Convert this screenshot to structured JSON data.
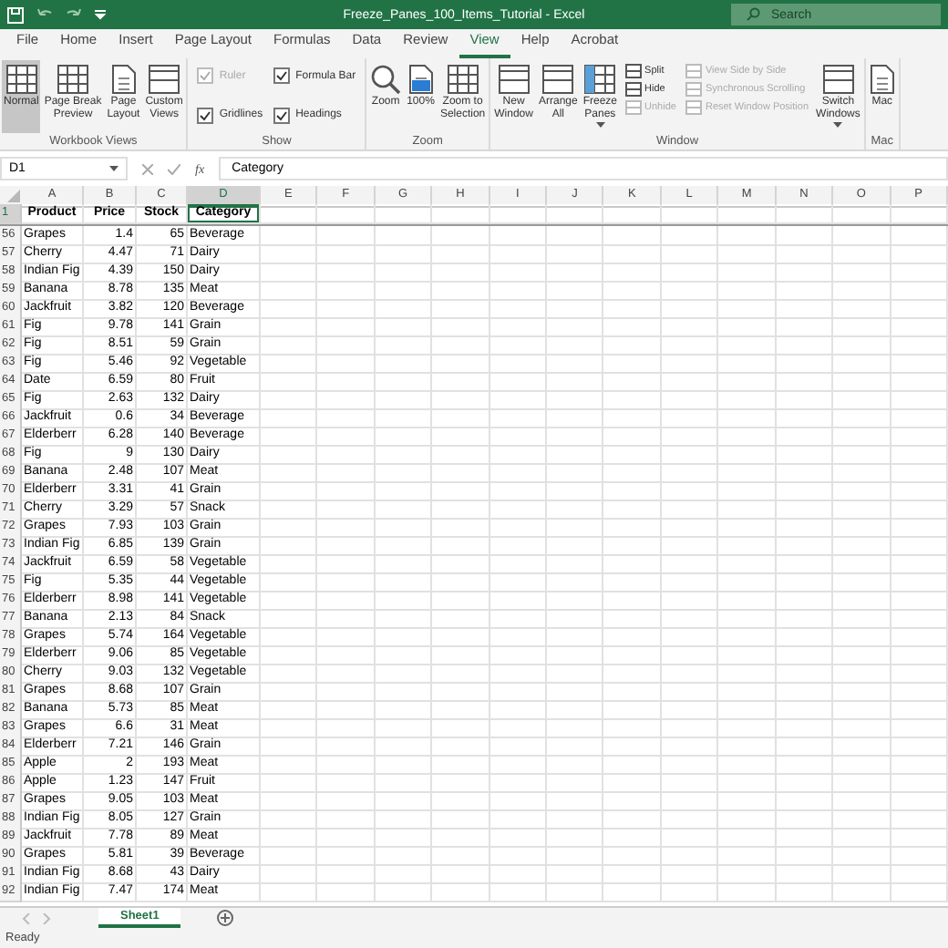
{
  "title_bar": {
    "title": "Freeze_Panes_100_Items_Tutorial  -  Excel",
    "search_placeholder": "Search"
  },
  "menu_tabs": [
    {
      "label": "File",
      "selected": false
    },
    {
      "label": "Home",
      "selected": false
    },
    {
      "label": "Insert",
      "selected": false
    },
    {
      "label": "Page Layout",
      "selected": false
    },
    {
      "label": "Formulas",
      "selected": false
    },
    {
      "label": "Data",
      "selected": false
    },
    {
      "label": "Review",
      "selected": false
    },
    {
      "label": "View",
      "selected": true
    },
    {
      "label": "Help",
      "selected": false
    },
    {
      "label": "Acrobat",
      "selected": false
    }
  ],
  "ribbon_groups": [
    {
      "name": "Workbook Views",
      "items": [
        {
          "kind": "large",
          "label": "Normal",
          "selected": true,
          "dropdown": false
        },
        {
          "kind": "large",
          "label": "Page Break\nPreview",
          "selected": false,
          "dropdown": false
        },
        {
          "kind": "large",
          "label": "Page\nLayout",
          "selected": false,
          "dropdown": false
        },
        {
          "kind": "large",
          "label": "Custom\nViews",
          "selected": false,
          "dropdown": false
        }
      ]
    },
    {
      "name": "Show",
      "items": [
        {
          "kind": "check",
          "label": "Ruler",
          "checked": true,
          "disabled": true
        },
        {
          "kind": "check",
          "label": "Gridlines",
          "checked": true,
          "disabled": false
        },
        {
          "kind": "check",
          "label": "Formula Bar",
          "checked": true,
          "disabled": false
        },
        {
          "kind": "check",
          "label": "Headings",
          "checked": true,
          "disabled": false
        }
      ]
    },
    {
      "name": "Zoom",
      "items": [
        {
          "kind": "large",
          "label": "Zoom",
          "selected": false,
          "dropdown": false
        },
        {
          "kind": "large",
          "label": "100%",
          "selected": false,
          "dropdown": false
        },
        {
          "kind": "large",
          "label": "Zoom to\nSelection",
          "selected": false,
          "dropdown": false
        }
      ]
    },
    {
      "name": "Window",
      "items": [
        {
          "kind": "large",
          "label": "New\nWindow",
          "selected": false,
          "dropdown": false
        },
        {
          "kind": "large",
          "label": "Arrange\nAll",
          "selected": false,
          "dropdown": false
        },
        {
          "kind": "large",
          "label": "Freeze\nPanes",
          "selected": false,
          "dropdown": true
        },
        {
          "kind": "stack",
          "items": [
            {
              "label": "Split",
              "disabled": false
            },
            {
              "label": "Hide",
              "disabled": false
            },
            {
              "label": "Unhide",
              "disabled": true
            }
          ]
        },
        {
          "kind": "stack",
          "items": [
            {
              "label": "View Side by Side",
              "disabled": true
            },
            {
              "label": "Synchronous Scrolling",
              "disabled": true
            },
            {
              "label": "Reset Window Position",
              "disabled": true
            }
          ]
        },
        {
          "kind": "large",
          "label": "Switch\nWindows",
          "selected": false,
          "dropdown": true
        }
      ]
    },
    {
      "name": "Mac",
      "items": [
        {
          "kind": "large",
          "label": "Mac",
          "selected": false,
          "dropdown": false
        }
      ]
    }
  ],
  "formula_bar": {
    "name_box": "D1",
    "function_label": "fx",
    "value": "Category"
  },
  "columns": [
    {
      "label": "A",
      "selected": false
    },
    {
      "label": "B",
      "selected": false
    },
    {
      "label": "C",
      "selected": false
    },
    {
      "label": "D",
      "selected": true
    },
    {
      "label": "E",
      "selected": false
    },
    {
      "label": "F",
      "selected": false
    },
    {
      "label": "G",
      "selected": false
    },
    {
      "label": "H",
      "selected": false
    },
    {
      "label": "I",
      "selected": false
    },
    {
      "label": "J",
      "selected": false
    },
    {
      "label": "K",
      "selected": false
    },
    {
      "label": "L",
      "selected": false
    },
    {
      "label": "M",
      "selected": false
    },
    {
      "label": "N",
      "selected": false
    },
    {
      "label": "O",
      "selected": false
    },
    {
      "label": "P",
      "selected": false
    }
  ],
  "frozen_row": {
    "number": "1",
    "selected": true,
    "cells": [
      "Product",
      "Price",
      "Stock",
      "Category"
    ]
  },
  "rows": [
    {
      "number": "56",
      "selected": false,
      "cells": [
        "Grapes",
        "1.4",
        "65",
        "Beverage"
      ]
    },
    {
      "number": "57",
      "selected": false,
      "cells": [
        "Cherry",
        "4.47",
        "71",
        "Dairy"
      ]
    },
    {
      "number": "58",
      "selected": false,
      "cells": [
        "Indian Fig",
        "4.39",
        "150",
        "Dairy"
      ]
    },
    {
      "number": "59",
      "selected": false,
      "cells": [
        "Banana",
        "8.78",
        "135",
        "Meat"
      ]
    },
    {
      "number": "60",
      "selected": false,
      "cells": [
        "Jackfruit",
        "3.82",
        "120",
        "Beverage"
      ]
    },
    {
      "number": "61",
      "selected": false,
      "cells": [
        "Fig",
        "9.78",
        "141",
        "Grain"
      ]
    },
    {
      "number": "62",
      "selected": false,
      "cells": [
        "Fig",
        "8.51",
        "59",
        "Grain"
      ]
    },
    {
      "number": "63",
      "selected": false,
      "cells": [
        "Fig",
        "5.46",
        "92",
        "Vegetable"
      ]
    },
    {
      "number": "64",
      "selected": false,
      "cells": [
        "Date",
        "6.59",
        "80",
        "Fruit"
      ]
    },
    {
      "number": "65",
      "selected": false,
      "cells": [
        "Fig",
        "2.63",
        "132",
        "Dairy"
      ]
    },
    {
      "number": "66",
      "selected": false,
      "cells": [
        "Jackfruit",
        "0.6",
        "34",
        "Beverage"
      ]
    },
    {
      "number": "67",
      "selected": false,
      "cells": [
        "Elderberr",
        "6.28",
        "140",
        "Beverage"
      ]
    },
    {
      "number": "68",
      "selected": false,
      "cells": [
        "Fig",
        "9",
        "130",
        "Dairy"
      ]
    },
    {
      "number": "69",
      "selected": false,
      "cells": [
        "Banana",
        "2.48",
        "107",
        "Meat"
      ]
    },
    {
      "number": "70",
      "selected": false,
      "cells": [
        "Elderberr",
        "3.31",
        "41",
        "Grain"
      ]
    },
    {
      "number": "71",
      "selected": false,
      "cells": [
        "Cherry",
        "3.29",
        "57",
        "Snack"
      ]
    },
    {
      "number": "72",
      "selected": false,
      "cells": [
        "Grapes",
        "7.93",
        "103",
        "Grain"
      ]
    },
    {
      "number": "73",
      "selected": false,
      "cells": [
        "Indian Fig",
        "6.85",
        "139",
        "Grain"
      ]
    },
    {
      "number": "74",
      "selected": false,
      "cells": [
        "Jackfruit",
        "6.59",
        "58",
        "Vegetable"
      ]
    },
    {
      "number": "75",
      "selected": false,
      "cells": [
        "Fig",
        "5.35",
        "44",
        "Vegetable"
      ]
    },
    {
      "number": "76",
      "selected": false,
      "cells": [
        "Elderberr",
        "8.98",
        "141",
        "Vegetable"
      ]
    },
    {
      "number": "77",
      "selected": false,
      "cells": [
        "Banana",
        "2.13",
        "84",
        "Snack"
      ]
    },
    {
      "number": "78",
      "selected": false,
      "cells": [
        "Grapes",
        "5.74",
        "164",
        "Vegetable"
      ]
    },
    {
      "number": "79",
      "selected": false,
      "cells": [
        "Elderberr",
        "9.06",
        "85",
        "Vegetable"
      ]
    },
    {
      "number": "80",
      "selected": false,
      "cells": [
        "Cherry",
        "9.03",
        "132",
        "Vegetable"
      ]
    },
    {
      "number": "81",
      "selected": false,
      "cells": [
        "Grapes",
        "8.68",
        "107",
        "Grain"
      ]
    },
    {
      "number": "82",
      "selected": false,
      "cells": [
        "Banana",
        "5.73",
        "85",
        "Meat"
      ]
    },
    {
      "number": "83",
      "selected": false,
      "cells": [
        "Grapes",
        "6.6",
        "31",
        "Meat"
      ]
    },
    {
      "number": "84",
      "selected": false,
      "cells": [
        "Elderberr",
        "7.21",
        "146",
        "Grain"
      ]
    },
    {
      "number": "85",
      "selected": false,
      "cells": [
        "Apple",
        "2",
        "193",
        "Meat"
      ]
    },
    {
      "number": "86",
      "selected": false,
      "cells": [
        "Apple",
        "1.23",
        "147",
        "Fruit"
      ]
    },
    {
      "number": "87",
      "selected": false,
      "cells": [
        "Grapes",
        "9.05",
        "103",
        "Meat"
      ]
    },
    {
      "number": "88",
      "selected": false,
      "cells": [
        "Indian Fig",
        "8.05",
        "127",
        "Grain"
      ]
    },
    {
      "number": "89",
      "selected": false,
      "cells": [
        "Jackfruit",
        "7.78",
        "89",
        "Meat"
      ]
    },
    {
      "number": "90",
      "selected": false,
      "cells": [
        "Grapes",
        "5.81",
        "39",
        "Beverage"
      ]
    },
    {
      "number": "91",
      "selected": false,
      "cells": [
        "Indian Fig",
        "8.68",
        "43",
        "Dairy"
      ]
    },
    {
      "number": "92",
      "selected": false,
      "cells": [
        "Indian Fig",
        "7.47",
        "174",
        "Meat"
      ]
    }
  ],
  "sheet_tabs": [
    {
      "label": "Sheet1",
      "selected": true
    }
  ],
  "status_bar": {
    "text": "Ready"
  }
}
